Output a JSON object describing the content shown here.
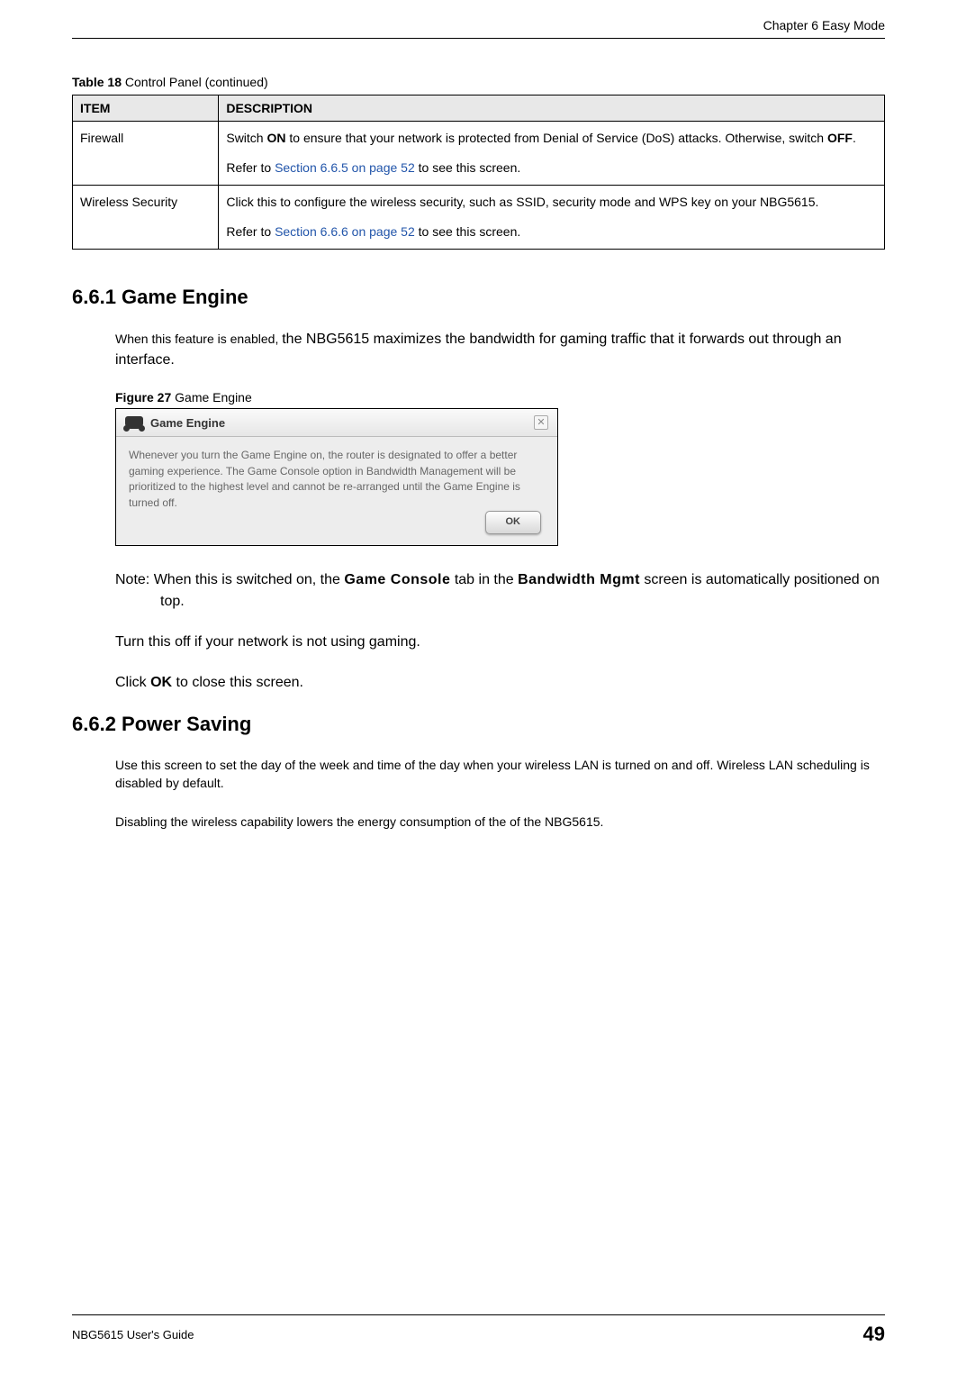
{
  "chapter_header": "Chapter 6 Easy Mode",
  "table_caption_prefix": "Table 18",
  "table_caption_text": "   Control Panel (continued)",
  "table": {
    "headers": {
      "item": "ITEM",
      "description": "DESCRIPTION"
    },
    "rows": [
      {
        "item": "Firewall",
        "desc_p1_pre": "Switch ",
        "desc_p1_b1": "ON",
        "desc_p1_mid": " to ensure that your network is protected from Denial of Service (DoS) attacks. Otherwise, switch ",
        "desc_p1_b2": "OFF",
        "desc_p1_post": ".",
        "desc_p2_pre": "Refer to ",
        "desc_p2_link": "Section 6.6.5 on page 52",
        "desc_p2_post": " to see this screen."
      },
      {
        "item": "Wireless Security",
        "desc_p1": "Click this to configure the wireless security, such as SSID, security mode and WPS key on your NBG5615.",
        "desc_p2_pre": "Refer to ",
        "desc_p2_link": "Section 6.6.6 on page 52",
        "desc_p2_post": " to see this screen."
      }
    ]
  },
  "section_661": {
    "heading": "6.6.1  Game Engine",
    "intro_small": "When this feature is enabled, ",
    "intro_large": "the NBG5615 maximizes the bandwidth for gaming traffic that it forwards out through an interface.",
    "figure_caption_prefix": "Figure 27",
    "figure_caption_text": "   Game Engine",
    "dialog": {
      "title": "Game Engine",
      "body": "Whenever you turn the Game Engine on, the router is designated to offer a better gaming experience. The Game Console option in Bandwidth Management will be prioritized to the highest level and cannot be re-arranged until the Game Engine is turned off.",
      "ok": "OK"
    },
    "note_pre": "Note: When this is switched on, the ",
    "note_b1": "Game Console",
    "note_mid": " tab in the ",
    "note_b2": "Bandwidth Mgmt",
    "note_post": " screen is automatically positioned on top.",
    "turn_off": "Turn this off if your network is not using gaming.",
    "click_ok_pre": "Click ",
    "click_ok_b": "OK",
    "click_ok_post": " to close this screen."
  },
  "section_662": {
    "heading": "6.6.2  Power Saving",
    "p1": "Use this screen to set the day of the week and time of the day when your wireless LAN is turned on and off. Wireless LAN scheduling is disabled by default.",
    "p2": "Disabling the wireless capability lowers the energy consumption of the of the NBG5615."
  },
  "footer": {
    "left": "NBG5615 User's Guide",
    "right": "49"
  }
}
